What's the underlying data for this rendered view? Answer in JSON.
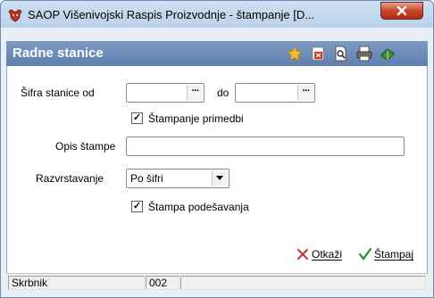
{
  "window": {
    "title": "SAOP Višenivojski Raspis Proizvodnje - štampanje [D..."
  },
  "header": {
    "title": "Radne stanice",
    "icons": [
      "star-icon",
      "delete-doc-icon",
      "preview-icon",
      "printer-icon",
      "book-icon"
    ]
  },
  "form": {
    "sifra_label": "Šifra stanice od",
    "sifra_od_value": "",
    "do_label": "do",
    "sifra_do_value": "",
    "stampanje_primedbi_label": "Štampanje primedbi",
    "stampanje_primedbi_checked": true,
    "opis_label": "Opis štampe",
    "opis_value": "",
    "razvrstavanje_label": "Razvrstavanje",
    "razvrstavanje_value": "Po šifri",
    "stampa_podesavanja_label": "Štampa podešavanja",
    "stampa_podesavanja_checked": true
  },
  "actions": {
    "cancel_label": "Otkaži",
    "cancel_hotkey": "O",
    "print_label": "Štampaj",
    "print_hotkey": "Š"
  },
  "status": {
    "user": "Skrbnik",
    "code": "002",
    "extra": ""
  },
  "colors": {
    "header_bg": "#6b89b8",
    "cancel_icon": "#c0392b",
    "print_icon": "#2e8b2e"
  }
}
